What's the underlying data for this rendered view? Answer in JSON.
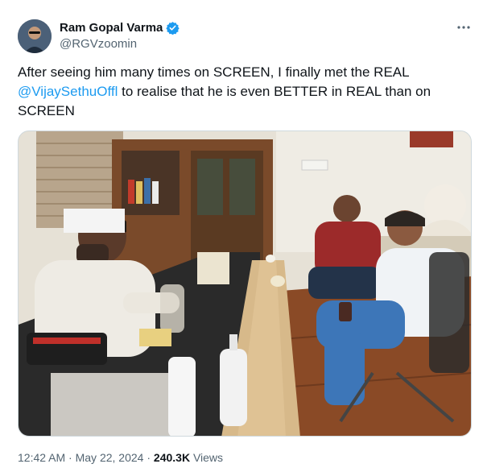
{
  "author": {
    "display_name": "Ram Gopal Varma",
    "handle": "@RGVzoomin",
    "verified": true
  },
  "tweet": {
    "text_before": "After seeing him many times on SCREEN, I finally met the REAL ",
    "mention": "@VijaySethuOffl",
    "text_after": " to realise that he is even BETTER in REAL than on SCREEN"
  },
  "meta": {
    "time": "12:42 AM",
    "sep1": " · ",
    "date": "May 22, 2024",
    "sep2": " · ",
    "views_count": "240.3K",
    "views_label": " Views"
  },
  "icons": {
    "more": "more-options-icon",
    "verified": "verified-badge-icon"
  },
  "colors": {
    "link": "#1d9bf0",
    "text": "#0f1419",
    "secondary": "#536471"
  }
}
